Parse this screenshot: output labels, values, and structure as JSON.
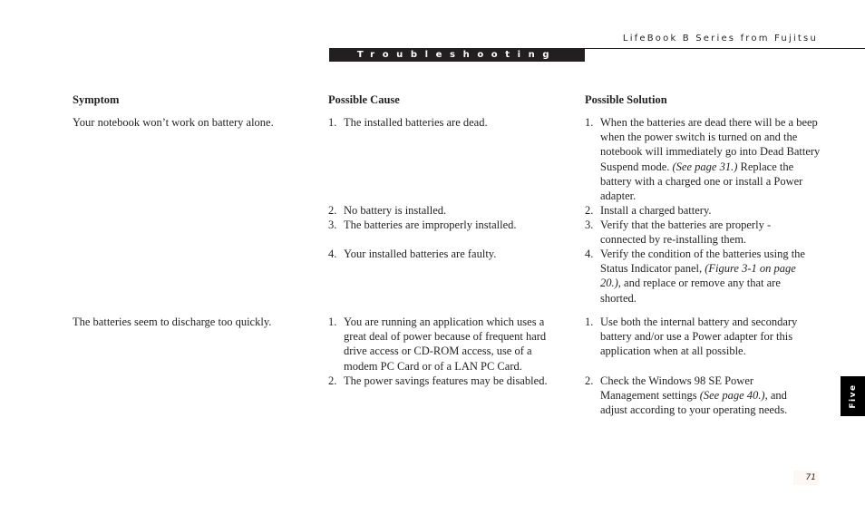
{
  "header": {
    "title": "LifeBook B Series from Fujitsu",
    "section": "Troubleshooting"
  },
  "table": {
    "columns": [
      "Symptom",
      "Possible Cause",
      "Possible Solution"
    ],
    "rows": [
      {
        "symptom": "Your notebook won’t work on battery alone.",
        "causes": [
          {
            "num": "1.",
            "text": "The installed batteries are dead."
          },
          {
            "num": "2.",
            "text": "No battery is installed."
          },
          {
            "num": "3.",
            "text": "The batteries are improperly installed."
          },
          {
            "num": "4.",
            "text": "Your installed batteries are faulty."
          }
        ],
        "solutions": [
          {
            "num": "1.",
            "pre": "When the batteries are dead there will be a beep when the power switch is turned on and the notebook will immediately go into Dead Battery Suspend mode. ",
            "ref": "(See page 31.)",
            "post": " Replace the battery with a charged one or install a Power adapter."
          },
          {
            "num": "2.",
            "pre": "Install a charged battery.",
            "ref": "",
            "post": ""
          },
          {
            "num": "3.",
            "pre": "Verify that the batteries are properly - connected by re-installing them.",
            "ref": "",
            "post": ""
          },
          {
            "num": "4.",
            "pre": "Verify the condition of the batteries using the Status Indicator panel, ",
            "ref": "(Figure 3-1 on page 20.)",
            "post": ", and replace or remove any that are shorted."
          }
        ]
      },
      {
        "symptom": "The batteries seem to discharge too quickly.",
        "causes": [
          {
            "num": "1.",
            "text": "You are running an application which uses a great deal of power because of frequent hard drive access or CD-ROM access, use of a modem PC Card or of a LAN PC Card."
          },
          {
            "num": "2.",
            "text": "The power savings features may be disabled."
          }
        ],
        "solutions": [
          {
            "num": "1.",
            "pre": "Use both the internal battery and secondary battery and/or use a Power adapter for this application when at all possible.",
            "ref": "",
            "post": ""
          },
          {
            "num": "2.",
            "pre": "Check the Windows 98 SE Power Management settings ",
            "ref": "(See page 40.)",
            "post": ", and adjust according to your operating needs."
          }
        ]
      }
    ]
  },
  "side_tab": "Five",
  "page_number": "71"
}
